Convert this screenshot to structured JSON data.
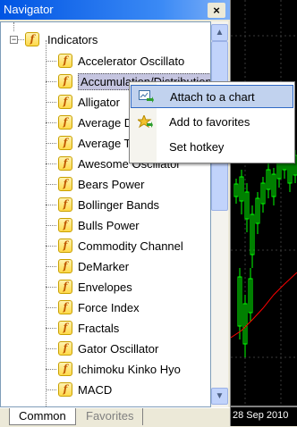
{
  "navigator": {
    "title": "Navigator",
    "close_glyph": "×",
    "root": {
      "label": "Indicators",
      "expander": "−",
      "icon": "f"
    },
    "items": [
      {
        "label": "Accelerator Oscillato"
      },
      {
        "label": "Accumulation/Distribution",
        "selected": true
      },
      {
        "label": "Alligator"
      },
      {
        "label": "Average Directional Movement Index"
      },
      {
        "label": "Average True Range"
      },
      {
        "label": "Awesome Oscillator"
      },
      {
        "label": "Bears Power"
      },
      {
        "label": "Bollinger Bands"
      },
      {
        "label": "Bulls Power"
      },
      {
        "label": "Commodity Channel"
      },
      {
        "label": "DeMarker"
      },
      {
        "label": "Envelopes"
      },
      {
        "label": "Force Index"
      },
      {
        "label": "Fractals"
      },
      {
        "label": "Gator Oscillator"
      },
      {
        "label": "Ichimoku Kinko Hyo"
      },
      {
        "label": "MACD"
      }
    ],
    "tabs": {
      "common": "Common",
      "favorites": "Favorites"
    }
  },
  "context_menu": {
    "items": [
      {
        "label": "Attach to a chart",
        "icon": "attach-chart-icon",
        "highlighted": true
      },
      {
        "label": "Add to favorites",
        "icon": "favorites-star-icon"
      },
      {
        "label": "Set hotkey",
        "icon": ""
      }
    ]
  },
  "chart": {
    "date_label": "28 Sep 2010",
    "colors": {
      "background": "#000000",
      "bars": "#00ff00",
      "ma_line": "#ff0000"
    }
  }
}
